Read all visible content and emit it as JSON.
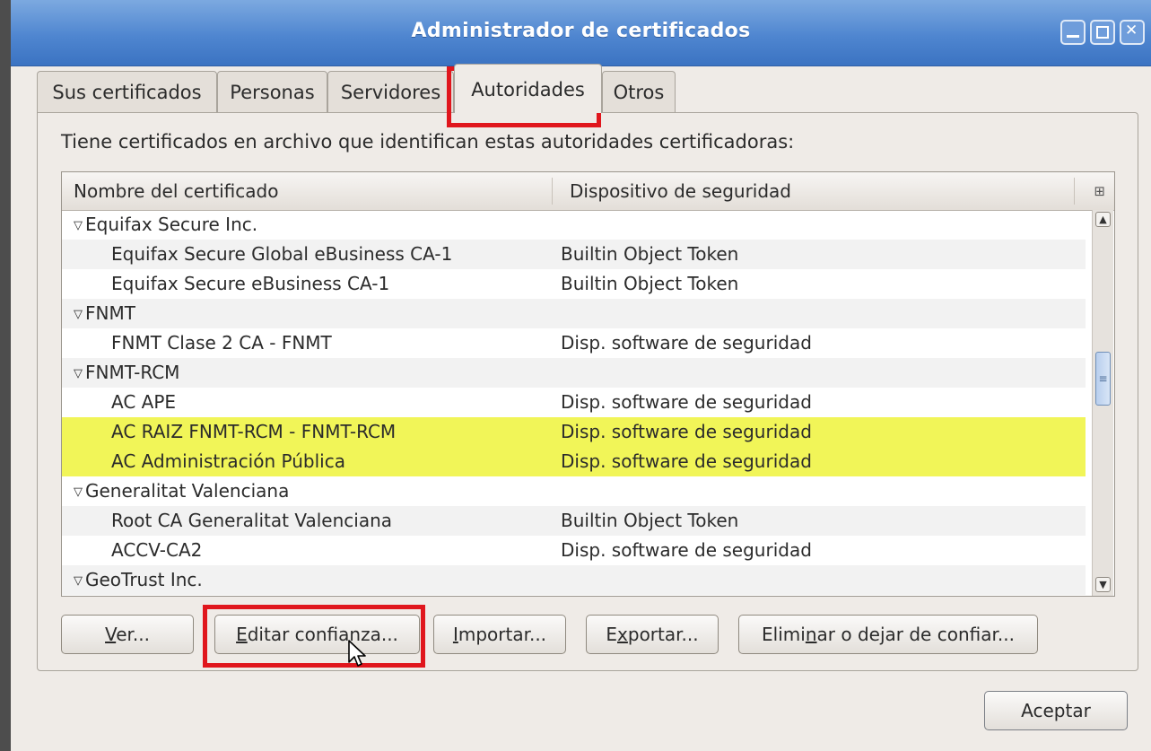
{
  "window": {
    "title": "Administrador de certificados"
  },
  "tabs": [
    "Sus certificados",
    "Personas",
    "Servidores",
    "Autoridades",
    "Otros"
  ],
  "intro_text": "Tiene certificados en archivo que identifican estas autoridades certificadoras:",
  "columns": [
    "Nombre del certificado",
    "Dispositivo de seguridad"
  ],
  "rows": [
    {
      "name": "Equifax Secure Inc.",
      "device": ""
    },
    {
      "name": "Equifax Secure Global eBusiness CA-1",
      "device": "Builtin Object Token"
    },
    {
      "name": "Equifax Secure eBusiness CA-1",
      "device": "Builtin Object Token"
    },
    {
      "name": "FNMT",
      "device": ""
    },
    {
      "name": "FNMT Clase 2 CA - FNMT",
      "device": "Disp. software de seguridad"
    },
    {
      "name": "FNMT-RCM",
      "device": ""
    },
    {
      "name": "AC APE",
      "device": "Disp. software de seguridad"
    },
    {
      "name": "AC RAIZ FNMT-RCM - FNMT-RCM",
      "device": "Disp. software de seguridad"
    },
    {
      "name": "AC Administración Pública",
      "device": "Disp. software de seguridad"
    },
    {
      "name": "Generalitat Valenciana",
      "device": ""
    },
    {
      "name": "Root CA Generalitat Valenciana",
      "device": "Builtin Object Token"
    },
    {
      "name": "ACCV-CA2",
      "device": "Disp. software de seguridad"
    },
    {
      "name": "GeoTrust Inc.",
      "device": ""
    }
  ],
  "buttons": {
    "view": {
      "pre": "",
      "ul": "V",
      "post": "er..."
    },
    "edit_trust": {
      "pre": "",
      "ul": "E",
      "post": "ditar confianza..."
    },
    "import": {
      "pre": "",
      "ul": "I",
      "post": "mportar..."
    },
    "export": {
      "pre": "E",
      "ul": "x",
      "post": "portar..."
    },
    "delete": {
      "pre": "Elimi",
      "ul": "n",
      "post": "ar o dejar de confiar..."
    },
    "ok": "Aceptar"
  },
  "colors": {
    "highlight": "#f1f558",
    "annotation": "#e0161d",
    "titlebar": "#4f86d0"
  },
  "icons": [
    "minimize-icon",
    "maximize-icon",
    "close-icon",
    "column-picker-icon",
    "expand-triangle-icon",
    "scroll-up-icon",
    "scroll-down-icon",
    "mouse-cursor-icon"
  ]
}
